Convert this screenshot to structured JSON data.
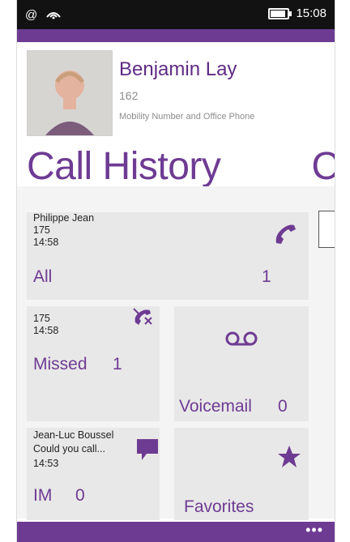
{
  "status": {
    "time": "15:08",
    "icons": [
      "at-sign-icon",
      "wifi-icon",
      "battery-icon"
    ],
    "battery_level": 0.8
  },
  "header": {
    "name": "Benjamin Lay",
    "extension": "162",
    "devices": "Mobility Number and Office Phone"
  },
  "page": {
    "title": "Call History",
    "next_title_peek": "C"
  },
  "tiles": {
    "all": {
      "line1": "Philippe Jean",
      "line2": "175",
      "line3": "14:58",
      "label": "All",
      "count": "1",
      "icon": "phone-icon"
    },
    "missed": {
      "line1": "175",
      "line2": "14:58",
      "label": "Missed",
      "count": "1",
      "icon": "missed-call-icon"
    },
    "voicemail": {
      "label": "Voicemail",
      "count": "0",
      "icon": "voicemail-icon"
    },
    "im": {
      "line1": "Jean-Luc Boussel",
      "line2": "Could you call...",
      "line3": "14:53",
      "label": "IM",
      "count": "0",
      "icon": "chat-icon"
    },
    "favorites": {
      "label": "Favorites",
      "icon": "star-icon"
    }
  },
  "appbar": {
    "more": "•••"
  },
  "colors": {
    "accent": "#6e3b93",
    "tile": "#e8e8e8"
  }
}
